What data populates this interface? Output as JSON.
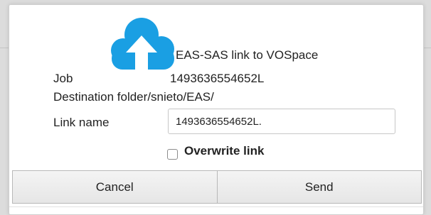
{
  "dialog": {
    "title": "EAS-SAS link to VOSpace",
    "icon": "cloud-upload-icon",
    "accent_color": "#1a9fe3"
  },
  "form": {
    "job_label": "Job",
    "job_value": "1493636554652L",
    "destination_label": "Destination folder",
    "destination_value": "/snieto/EAS/",
    "link_name_label": "Link name",
    "link_name_value": "1493636554652L.",
    "overwrite_label": "Overwrite link",
    "overwrite_checked": false
  },
  "buttons": {
    "cancel_label": "Cancel",
    "send_label": "Send"
  }
}
